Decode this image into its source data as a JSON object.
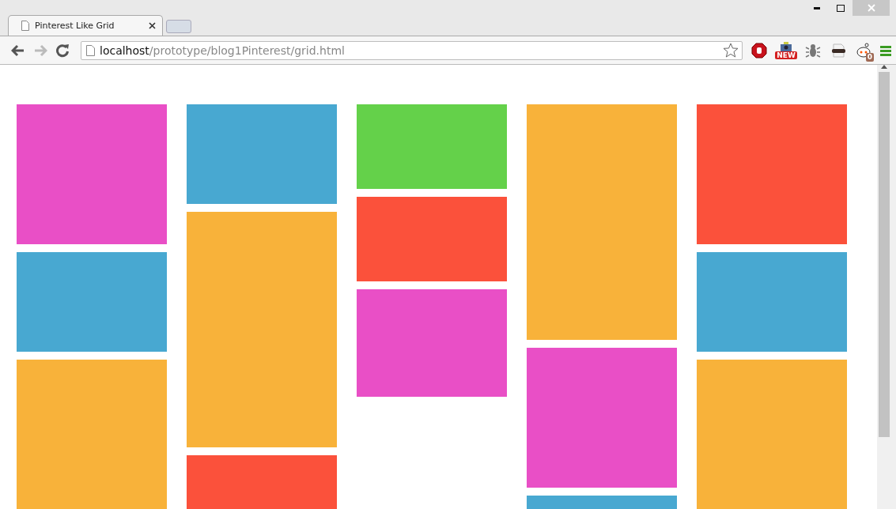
{
  "tab": {
    "title": "Pinterest Like Grid",
    "selected": true
  },
  "address_bar": {
    "host": "localhost",
    "path": "/prototype/blog1Pinterest/grid.html"
  },
  "extensions": [
    {
      "kind": "stop"
    },
    {
      "kind": "camera",
      "badge": "NEW"
    },
    {
      "kind": "bug"
    },
    {
      "kind": "mask"
    },
    {
      "kind": "alien",
      "badge": "0"
    }
  ],
  "columns": [
    {
      "tiles": [
        {
          "kind": "l",
          "color": "#e94fc6"
        },
        {
          "kind": "s",
          "color": "#48a8d1"
        },
        {
          "kind": "xl",
          "color": "#f8b23a"
        }
      ]
    },
    {
      "tiles": [
        {
          "kind": "s",
          "color": "#48a8d1"
        },
        {
          "kind": "xl",
          "color": "#f8b23a"
        },
        {
          "kind": "l",
          "color": "#fb513b"
        }
      ]
    },
    {
      "tiles": [
        {
          "kind": "xs",
          "color": "#64d14a"
        },
        {
          "kind": "xs",
          "color": "#fb513b"
        },
        {
          "kind": "m",
          "color": "#e94fc6"
        }
      ]
    },
    {
      "tiles": [
        {
          "kind": "xl",
          "color": "#f8b23a"
        },
        {
          "kind": "l",
          "color": "#e94fc6"
        },
        {
          "kind": "s",
          "color": "#48a8d1"
        }
      ]
    },
    {
      "tiles": [
        {
          "kind": "l",
          "color": "#fb513b"
        },
        {
          "kind": "s",
          "color": "#48a8d1"
        },
        {
          "kind": "xl",
          "color": "#f8b23a"
        }
      ]
    }
  ]
}
